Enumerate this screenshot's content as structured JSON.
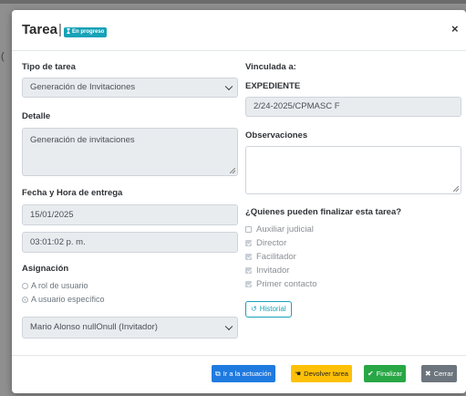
{
  "modal": {
    "title": "Tarea",
    "title_separator": "|",
    "status_badge": "En progreso",
    "close_symbol": "×"
  },
  "left": {
    "task_type_label": "Tipo de tarea",
    "task_type_value": "Generación de Invitaciones",
    "detail_label": "Detalle",
    "detail_value": "Generación de invitaciones",
    "delivery_label": "Fecha y Hora de entrega",
    "delivery_date": "15/01/2025",
    "delivery_time": "03:01:02 p. m.",
    "assignment_label": "Asignación",
    "radio_role": "A rol de usuario",
    "radio_user": "A usuario específico",
    "assigned_user": "Mario Alonso nullOnull (Invitador)"
  },
  "right": {
    "linked_label": "Vinculada a:",
    "linked_type": "EXPEDIENTE",
    "linked_value": "2/24-2025/CPMASC F",
    "observations_label": "Observaciones",
    "observations_value": "",
    "finalizers_label": "¿Quienes pueden finalizar esta tarea?",
    "finalizers": [
      {
        "label": "Auxiliar judicial",
        "checked": false
      },
      {
        "label": "Director",
        "checked": true
      },
      {
        "label": "Facilitador",
        "checked": true
      },
      {
        "label": "Invitador",
        "checked": true
      },
      {
        "label": "Primer contacto",
        "checked": true
      }
    ],
    "history_button": "Historial"
  },
  "footer": {
    "goto_action": "Ir a la actuación",
    "return_task": "Devolver tarea",
    "finish": "Finalizar",
    "close": "Cerrar"
  },
  "colors": {
    "primary": "#1f7ae0",
    "info": "#17a2b8",
    "warning": "#ffc107",
    "success": "#28a745",
    "secondary": "#6c757d"
  }
}
